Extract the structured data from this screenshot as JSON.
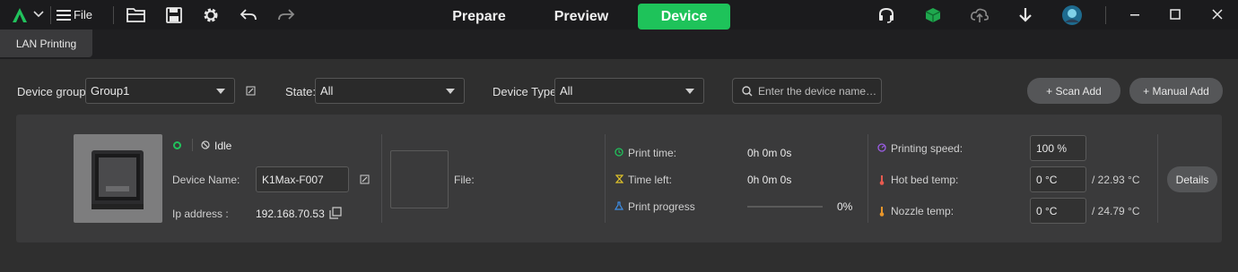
{
  "colors": {
    "accent": "#1ec35a",
    "background": "#2f2f2f",
    "card": "#3a3a3b"
  },
  "topbar": {
    "file_label": "File",
    "tabs": [
      {
        "label": "Prepare",
        "active": false
      },
      {
        "label": "Preview",
        "active": false
      },
      {
        "label": "Device",
        "active": true
      }
    ],
    "icons": [
      "app-logo-icon",
      "hamburger-menu-icon",
      "open-folder-icon",
      "save-icon",
      "settings-gear-icon",
      "undo-icon",
      "redo-icon",
      "headset-support-icon",
      "cube-icon",
      "cloud-upload-icon",
      "download-arrow-icon",
      "user-avatar-icon",
      "minimize-icon",
      "maximize-icon",
      "close-icon"
    ]
  },
  "subtab": {
    "label": "LAN Printing"
  },
  "filters": {
    "device_group_label": "Device group:",
    "device_group_value": "Group1",
    "state_label": "State:",
    "state_value": "All",
    "device_type_label": "Device Type:",
    "device_type_value": "All",
    "search_placeholder": "Enter the device name…",
    "scan_add_label": "+ Scan Add",
    "manual_add_label": "+ Manual Add"
  },
  "device": {
    "status": "Idle",
    "name_label": "Device Name:",
    "name_value": "K1Max-F007",
    "ip_label": "Ip address :",
    "ip_value": "192.168.70.53",
    "file_label": "File:",
    "print_time_label": "Print time:",
    "print_time_value": "0h 0m 0s",
    "time_left_label": "Time left:",
    "time_left_value": "0h 0m 0s",
    "print_progress_label": "Print progress",
    "print_progress_value": "0%",
    "print_progress_fraction": 0,
    "printing_speed_label": "Printing speed:",
    "printing_speed_value": "100 %",
    "hot_bed_label": "Hot bed temp:",
    "hot_bed_value": "0 °C",
    "hot_bed_current": "/ 22.93 °C",
    "nozzle_label": "Nozzle temp:",
    "nozzle_value": "0 °C",
    "nozzle_current": "/ 24.79 °C",
    "details_label": "Details"
  }
}
